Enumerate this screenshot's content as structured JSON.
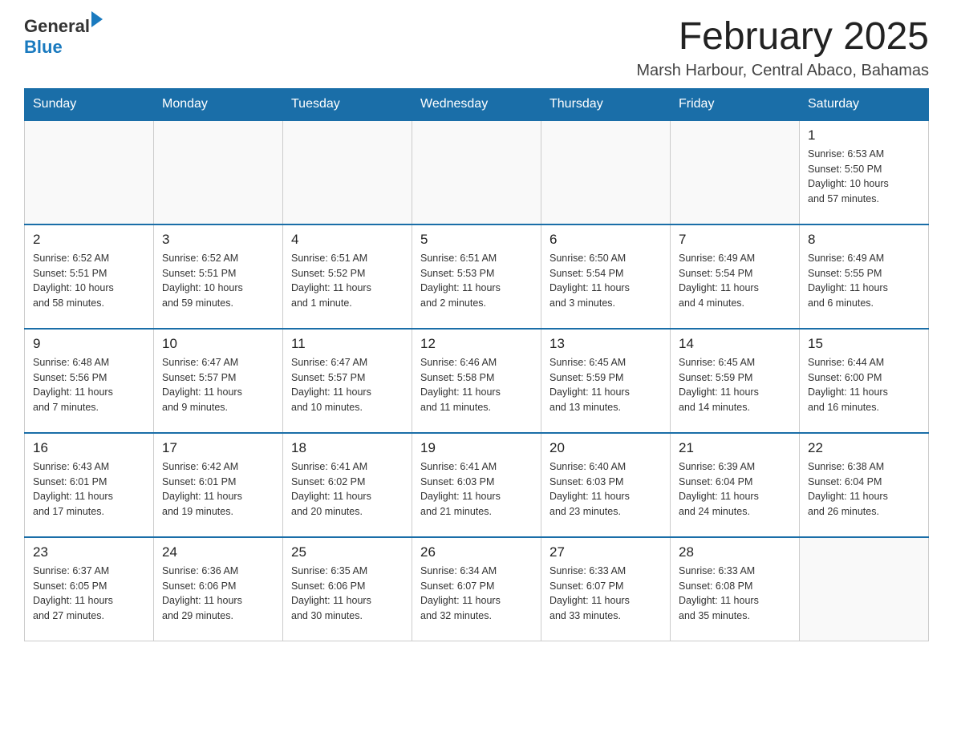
{
  "logo": {
    "general": "General",
    "arrow": "▶",
    "blue": "Blue"
  },
  "title": "February 2025",
  "location": "Marsh Harbour, Central Abaco, Bahamas",
  "days_of_week": [
    "Sunday",
    "Monday",
    "Tuesday",
    "Wednesday",
    "Thursday",
    "Friday",
    "Saturday"
  ],
  "weeks": [
    [
      {
        "day": "",
        "info": ""
      },
      {
        "day": "",
        "info": ""
      },
      {
        "day": "",
        "info": ""
      },
      {
        "day": "",
        "info": ""
      },
      {
        "day": "",
        "info": ""
      },
      {
        "day": "",
        "info": ""
      },
      {
        "day": "1",
        "info": "Sunrise: 6:53 AM\nSunset: 5:50 PM\nDaylight: 10 hours\nand 57 minutes."
      }
    ],
    [
      {
        "day": "2",
        "info": "Sunrise: 6:52 AM\nSunset: 5:51 PM\nDaylight: 10 hours\nand 58 minutes."
      },
      {
        "day": "3",
        "info": "Sunrise: 6:52 AM\nSunset: 5:51 PM\nDaylight: 10 hours\nand 59 minutes."
      },
      {
        "day": "4",
        "info": "Sunrise: 6:51 AM\nSunset: 5:52 PM\nDaylight: 11 hours\nand 1 minute."
      },
      {
        "day": "5",
        "info": "Sunrise: 6:51 AM\nSunset: 5:53 PM\nDaylight: 11 hours\nand 2 minutes."
      },
      {
        "day": "6",
        "info": "Sunrise: 6:50 AM\nSunset: 5:54 PM\nDaylight: 11 hours\nand 3 minutes."
      },
      {
        "day": "7",
        "info": "Sunrise: 6:49 AM\nSunset: 5:54 PM\nDaylight: 11 hours\nand 4 minutes."
      },
      {
        "day": "8",
        "info": "Sunrise: 6:49 AM\nSunset: 5:55 PM\nDaylight: 11 hours\nand 6 minutes."
      }
    ],
    [
      {
        "day": "9",
        "info": "Sunrise: 6:48 AM\nSunset: 5:56 PM\nDaylight: 11 hours\nand 7 minutes."
      },
      {
        "day": "10",
        "info": "Sunrise: 6:47 AM\nSunset: 5:57 PM\nDaylight: 11 hours\nand 9 minutes."
      },
      {
        "day": "11",
        "info": "Sunrise: 6:47 AM\nSunset: 5:57 PM\nDaylight: 11 hours\nand 10 minutes."
      },
      {
        "day": "12",
        "info": "Sunrise: 6:46 AM\nSunset: 5:58 PM\nDaylight: 11 hours\nand 11 minutes."
      },
      {
        "day": "13",
        "info": "Sunrise: 6:45 AM\nSunset: 5:59 PM\nDaylight: 11 hours\nand 13 minutes."
      },
      {
        "day": "14",
        "info": "Sunrise: 6:45 AM\nSunset: 5:59 PM\nDaylight: 11 hours\nand 14 minutes."
      },
      {
        "day": "15",
        "info": "Sunrise: 6:44 AM\nSunset: 6:00 PM\nDaylight: 11 hours\nand 16 minutes."
      }
    ],
    [
      {
        "day": "16",
        "info": "Sunrise: 6:43 AM\nSunset: 6:01 PM\nDaylight: 11 hours\nand 17 minutes."
      },
      {
        "day": "17",
        "info": "Sunrise: 6:42 AM\nSunset: 6:01 PM\nDaylight: 11 hours\nand 19 minutes."
      },
      {
        "day": "18",
        "info": "Sunrise: 6:41 AM\nSunset: 6:02 PM\nDaylight: 11 hours\nand 20 minutes."
      },
      {
        "day": "19",
        "info": "Sunrise: 6:41 AM\nSunset: 6:03 PM\nDaylight: 11 hours\nand 21 minutes."
      },
      {
        "day": "20",
        "info": "Sunrise: 6:40 AM\nSunset: 6:03 PM\nDaylight: 11 hours\nand 23 minutes."
      },
      {
        "day": "21",
        "info": "Sunrise: 6:39 AM\nSunset: 6:04 PM\nDaylight: 11 hours\nand 24 minutes."
      },
      {
        "day": "22",
        "info": "Sunrise: 6:38 AM\nSunset: 6:04 PM\nDaylight: 11 hours\nand 26 minutes."
      }
    ],
    [
      {
        "day": "23",
        "info": "Sunrise: 6:37 AM\nSunset: 6:05 PM\nDaylight: 11 hours\nand 27 minutes."
      },
      {
        "day": "24",
        "info": "Sunrise: 6:36 AM\nSunset: 6:06 PM\nDaylight: 11 hours\nand 29 minutes."
      },
      {
        "day": "25",
        "info": "Sunrise: 6:35 AM\nSunset: 6:06 PM\nDaylight: 11 hours\nand 30 minutes."
      },
      {
        "day": "26",
        "info": "Sunrise: 6:34 AM\nSunset: 6:07 PM\nDaylight: 11 hours\nand 32 minutes."
      },
      {
        "day": "27",
        "info": "Sunrise: 6:33 AM\nSunset: 6:07 PM\nDaylight: 11 hours\nand 33 minutes."
      },
      {
        "day": "28",
        "info": "Sunrise: 6:33 AM\nSunset: 6:08 PM\nDaylight: 11 hours\nand 35 minutes."
      },
      {
        "day": "",
        "info": ""
      }
    ]
  ]
}
